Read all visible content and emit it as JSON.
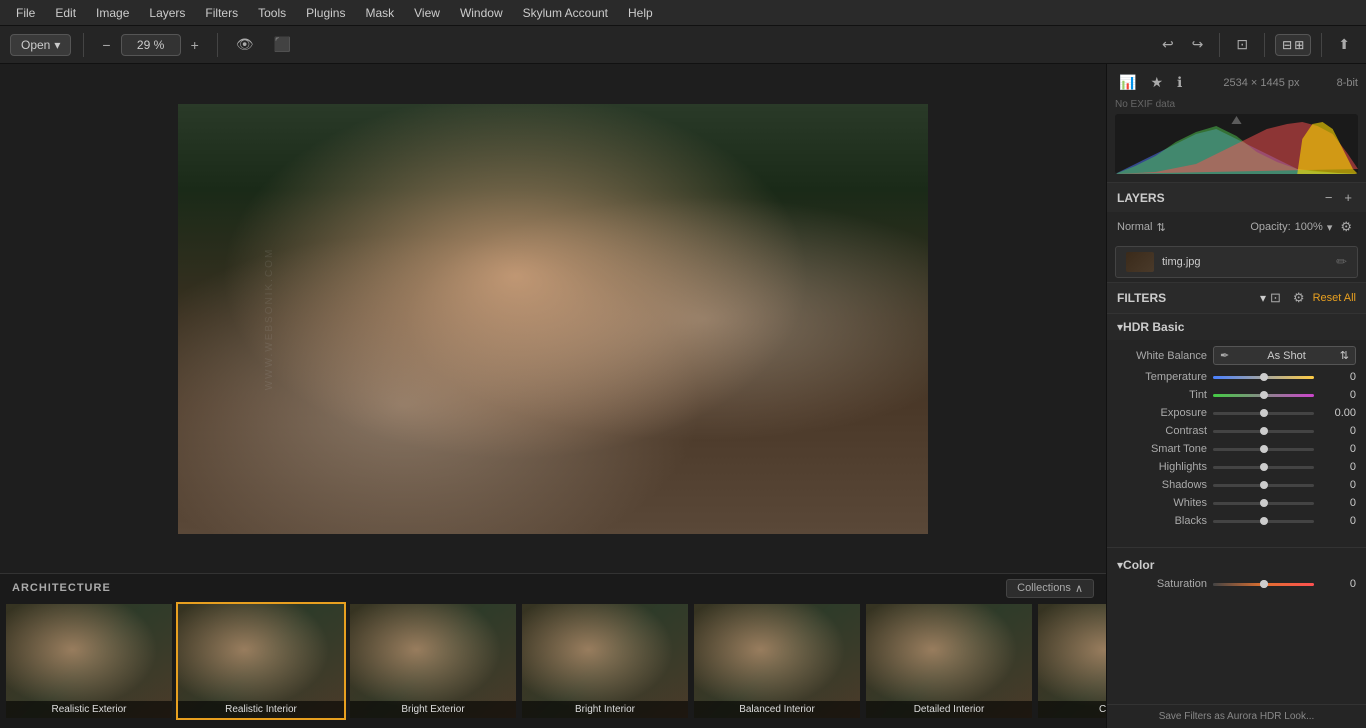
{
  "menu": {
    "items": [
      "File",
      "Edit",
      "Image",
      "Layers",
      "Filters",
      "Tools",
      "Plugins",
      "Mask",
      "View",
      "Window",
      "Skylum Account",
      "Help"
    ]
  },
  "toolbar": {
    "open_label": "Open",
    "zoom": "29 %",
    "undo_icon": "↩",
    "redo_icon": "↪"
  },
  "image": {
    "filename": "timg.jpg",
    "dimensions": "2534 × 1445 px",
    "bit_depth": "8-bit",
    "exif": "No EXIF data"
  },
  "layers": {
    "title": "LAYERS",
    "blend_mode": "Normal",
    "opacity": "100%",
    "layer_name": "timg.jpg"
  },
  "filters": {
    "title": "FILTERS",
    "reset_label": "Reset All",
    "hdr_basic": {
      "title": "HDR Basic",
      "white_balance_label": "White Balance",
      "white_balance_value": "As Shot",
      "temperature_label": "Temperature",
      "temperature_value": "0",
      "tint_label": "Tint",
      "tint_value": "0",
      "exposure_label": "Exposure",
      "exposure_value": "0.00",
      "contrast_label": "Contrast",
      "contrast_value": "0",
      "smart_tone_label": "Smart Tone",
      "smart_tone_value": "0",
      "highlights_label": "Highlights",
      "highlights_value": "0",
      "shadows_label": "Shadows",
      "shadows_value": "0",
      "whites_label": "Whites",
      "whites_value": "0",
      "blacks_label": "Blacks",
      "blacks_value": "0"
    },
    "color": {
      "title": "Color",
      "saturation_label": "Saturation",
      "saturation_value": "0"
    }
  },
  "filmstrip": {
    "category": "ARCHITECTURE",
    "collections_label": "Collections",
    "items": [
      {
        "label": "Realistic Exterior",
        "active": false
      },
      {
        "label": "Realistic Interior",
        "active": true
      },
      {
        "label": "Bright Exterior",
        "active": false
      },
      {
        "label": "Bright Interior",
        "active": false
      },
      {
        "label": "Balanced Interior",
        "active": false
      },
      {
        "label": "Detailed Interior",
        "active": false
      },
      {
        "label": "Cityscape",
        "active": false
      }
    ]
  },
  "bottom_bar": {
    "save_label": "Save Filters as Aurora HDR Look..."
  }
}
